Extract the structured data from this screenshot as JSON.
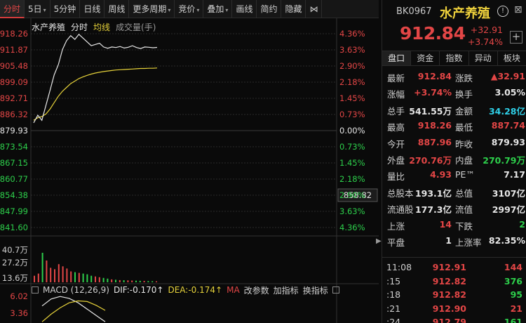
{
  "toolbar": {
    "buttons": [
      "分时",
      "5日",
      "5分钟",
      "日线",
      "周线",
      "更多周期",
      "竞价",
      "叠加",
      "画线",
      "简约",
      "隐藏",
      "⋈"
    ]
  },
  "legend": {
    "name": "水产养殖",
    "fenshi": "分时",
    "junxian": "均线",
    "volume": "成交量(手)"
  },
  "axis": {
    "left": [
      "918.26",
      "911.87",
      "905.48",
      "899.09",
      "892.71",
      "886.32",
      "879.93",
      "873.54",
      "867.15",
      "860.77",
      "854.38",
      "847.99",
      "841.60"
    ],
    "right": [
      "4.36%",
      "3.63%",
      "2.90%",
      "2.18%",
      "1.45%",
      "0.73%",
      "0.00%",
      "0.73%",
      "1.45%",
      "2.18%",
      "2.90%",
      "3.63%",
      "4.36%"
    ],
    "cursor_value": "858.82",
    "volume": [
      "40.7万",
      "27.2万",
      "13.6万"
    ],
    "macd": [
      "6.02",
      "3.36"
    ]
  },
  "macd_bar": {
    "label": "MACD (12,26,9)",
    "dif": "DIF:-0.170↑",
    "dea": "DEA:-0.174↑",
    "ma": "MA",
    "change_params": "改参数",
    "add_indicator": "加指标",
    "swap_indicator": "换指标"
  },
  "panel": {
    "code": "BK0967",
    "name": "水产养殖",
    "info": "!",
    "close": "⊠",
    "price": "912.84",
    "change": "+32.91",
    "change_pct": "+3.74%",
    "add": "+",
    "tabs": [
      "盘口",
      "资金",
      "指数",
      "异动",
      "板块"
    ],
    "rows": [
      {
        "l1": "最新",
        "v1": "912.84",
        "c1": "red",
        "l2": "涨跌",
        "v2": "▲32.91",
        "c2": "red"
      },
      {
        "l1": "涨幅",
        "v1": "+3.74%",
        "c1": "red",
        "l2": "换手",
        "v2": "3.05%",
        "c2": "white"
      },
      {
        "l1": "总手",
        "v1": "541.55万",
        "c1": "white",
        "l2": "金额",
        "v2": "34.28亿",
        "c2": "cyan"
      },
      {
        "l1": "最高",
        "v1": "918.26",
        "c1": "red",
        "l2": "最低",
        "v2": "887.74",
        "c2": "red"
      },
      {
        "l1": "今开",
        "v1": "887.96",
        "c1": "red",
        "l2": "昨收",
        "v2": "879.93",
        "c2": "white"
      },
      {
        "l1": "外盘",
        "v1": "270.76万",
        "c1": "red",
        "l2": "内盘",
        "v2": "270.79万",
        "c2": "green"
      },
      {
        "l1": "量比",
        "v1": "4.93",
        "c1": "red",
        "l2": "PE™",
        "v2": "7.17",
        "c2": "white"
      },
      {
        "l1": "总股本",
        "v1": "193.1亿",
        "c1": "white",
        "l2": "总值",
        "v2": "3107亿",
        "c2": "white"
      },
      {
        "l1": "流通股",
        "v1": "177.3亿",
        "c1": "white",
        "l2": "流值",
        "v2": "2997亿",
        "c2": "white"
      },
      {
        "l1": "上涨",
        "v1": "14",
        "c1": "red",
        "l2": "下跌",
        "v2": "2",
        "c2": "green"
      },
      {
        "l1": "平盘",
        "v1": "1",
        "c1": "white",
        "l2": "上涨率",
        "v2": "82.35%",
        "c2": "white"
      }
    ],
    "ticks": [
      {
        "time": "11:08",
        "price": "912.91",
        "vol": "144",
        "vcolor": "red"
      },
      {
        "time": ":15",
        "price": "912.82",
        "vol": "376",
        "vcolor": "green"
      },
      {
        "time": ":18",
        "price": "912.82",
        "vol": "95",
        "vcolor": "green"
      },
      {
        "time": ":21",
        "price": "912.90",
        "vol": "21",
        "vcolor": "red"
      },
      {
        "time": ":24",
        "price": "912.79",
        "vol": "161",
        "vcolor": "green"
      }
    ]
  },
  "colors": {
    "up": "#e34646",
    "down": "#2dcf4b",
    "price_line": "#e8e8e8",
    "avg_line": "#e6d23a",
    "grid": "#2a2a2a"
  },
  "chart_data": {
    "type": "line",
    "base": 879.93,
    "price": [
      883.0,
      886.0,
      884.0,
      890.0,
      896.0,
      902.0,
      906.0,
      912.0,
      915.5,
      917.5,
      916.0,
      918.0,
      916.5,
      915.0,
      913.5,
      914.0,
      914.5,
      913.0,
      912.5,
      913.0,
      912.8,
      913.2,
      912.6,
      912.9,
      913.5,
      912.8,
      912.4,
      913.0,
      912.9,
      912.7,
      912.84
    ],
    "avg": [
      884.0,
      885.0,
      885.5,
      886.5,
      888.5,
      891.0,
      893.5,
      895.5,
      897.0,
      898.5,
      899.5,
      900.5,
      901.2,
      901.8,
      902.3,
      902.7,
      903.0,
      903.3,
      903.5,
      903.7,
      903.9,
      904.0,
      904.1,
      904.2,
      904.3,
      904.4,
      904.5,
      904.5,
      904.6,
      904.6,
      904.7
    ],
    "volume": [
      90000,
      120000,
      407000,
      300000,
      200000,
      180000,
      250000,
      220000,
      190000,
      150000,
      140000,
      130000,
      120000,
      110000,
      90000,
      80000,
      70000,
      60000,
      50000,
      40000,
      35000,
      30000,
      28000,
      26000,
      24000,
      22000,
      20000,
      18000,
      16000,
      15000,
      14000
    ],
    "dif": [
      4.5,
      5.6,
      6.0,
      5.7,
      5.0,
      4.0,
      3.0,
      2.0
    ],
    "dea": [
      2.0,
      3.2,
      4.2,
      5.0,
      5.3,
      5.2,
      4.6,
      3.8
    ]
  }
}
